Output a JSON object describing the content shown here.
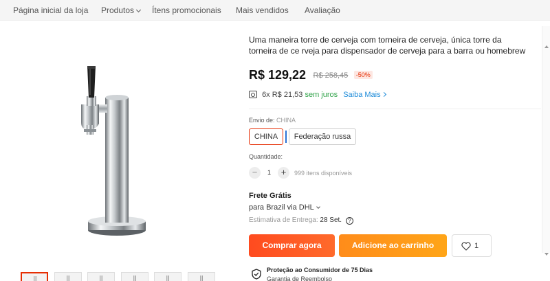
{
  "nav": {
    "items": [
      {
        "label": "Página inicial da loja"
      },
      {
        "label": "Produtos"
      },
      {
        "label": "Ítens promocionais"
      },
      {
        "label": "Mais vendidos"
      },
      {
        "label": "Avaliação"
      }
    ]
  },
  "product": {
    "title": "Uma maneira torre de cerveja com torneira de cerveja, única torre da torneira de ce rveja para dispensador de cerveja para a barra ou homebrew",
    "price": "R$ 129,22",
    "original_price": "R$ 258,45",
    "discount": "-50%",
    "installments": {
      "text": "6x R$ 21,53",
      "interest": "sem juros",
      "link": "Saiba Mais"
    }
  },
  "shipping": {
    "label": "Envio de:",
    "selected": "CHINA",
    "options": [
      "CHINA",
      "Federação russa"
    ]
  },
  "quantity": {
    "label": "Quantidade:",
    "minus": "−",
    "plus": "+",
    "value": "1",
    "available": "999 itens disponíveis"
  },
  "delivery": {
    "free": "Frete Grátis",
    "via": "para Brazil via DHL",
    "estimate_label": "Estimativa de Entrega:",
    "estimate_date": "28 Set.",
    "help": "?"
  },
  "actions": {
    "buy": "Comprar agora",
    "cart": "Adicione ao carrinho",
    "wishlist_count": "1"
  },
  "protection": {
    "title": "Proteção ao Consumidor de 75 Dias",
    "subtitle": "Garantia de Reembolso"
  },
  "colors": {
    "accent": "#e62e04",
    "buy_button": "#ff4b1f",
    "cart_button": "#ff9a12",
    "link": "#1d8bd9",
    "green": "#31a34a"
  }
}
